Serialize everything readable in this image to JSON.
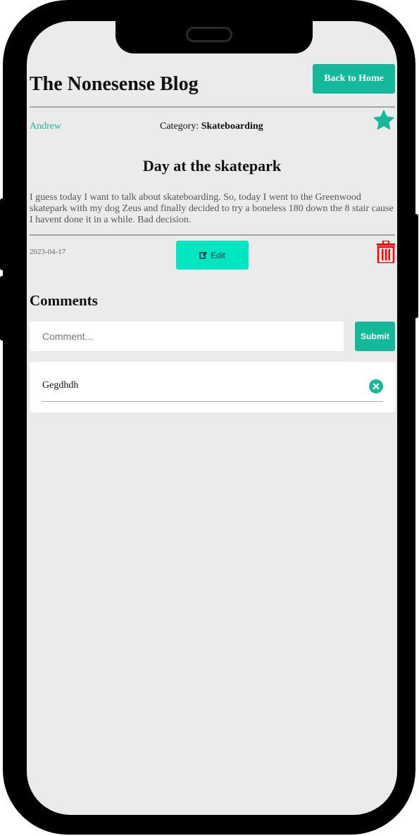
{
  "blog": {
    "title": "The Nonesense Blog",
    "back_label": "Back to Home"
  },
  "post": {
    "author": "Andrew",
    "category_label": "Category:",
    "category": "Skateboarding",
    "title": "Day at the skatepark",
    "body": "I guess today I want to talk about skateboarding. So, today I went to the Greenwood skatepark with my dog Zeus and finally decided to try a boneless 180 down the 8 stair cause I havent done it in a while. Bad decision.",
    "date": "2023-04-17",
    "edit_label": "Edit",
    "favorite_icon": "star-icon",
    "delete_icon": "trash-icon"
  },
  "comments": {
    "heading": "Comments",
    "placeholder": "Comment...",
    "submit_label": "Submit",
    "items": [
      {
        "text": "Gegdhdh",
        "delete_icon": "close-circle-icon"
      }
    ]
  },
  "colors": {
    "accent": "#14b89a",
    "edit": "#00e6c3",
    "danger": "#ff0000",
    "link": "#1cb79a"
  }
}
